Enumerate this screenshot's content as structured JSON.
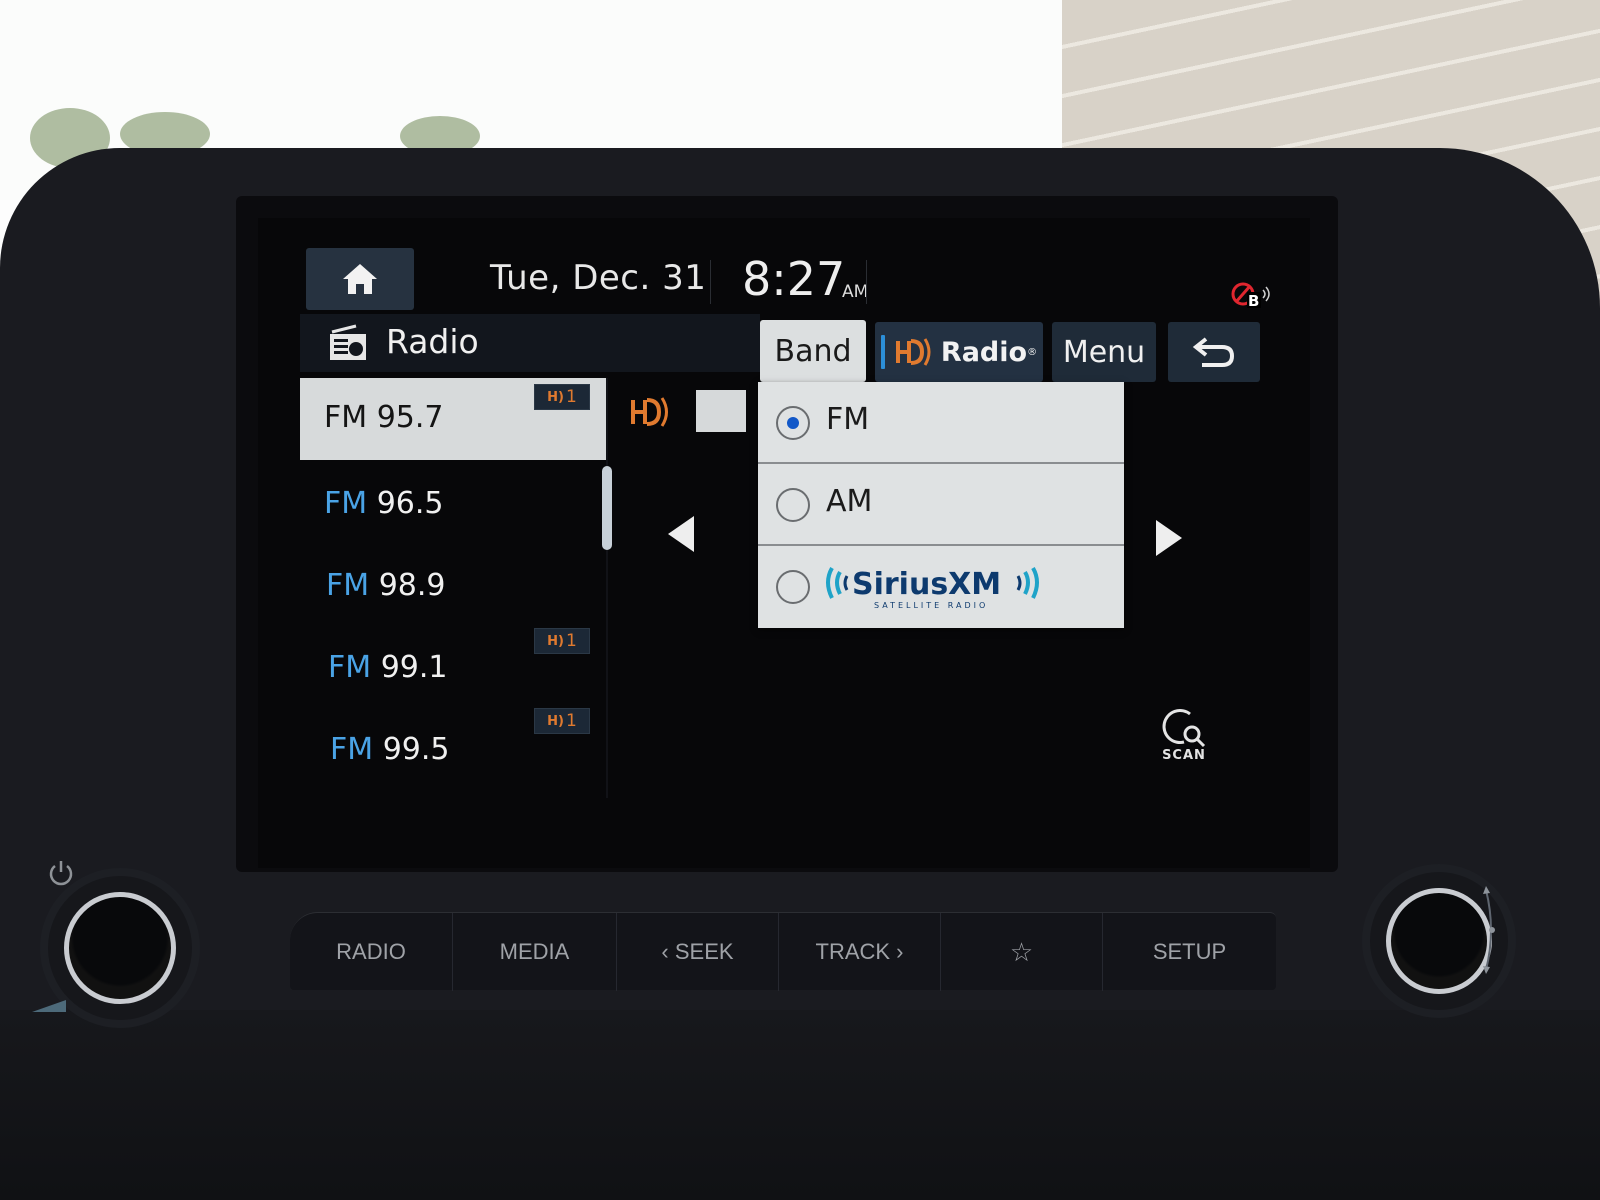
{
  "status_bar": {
    "home_icon": "home-icon",
    "date": "Tue, Dec. 31",
    "time": "8:27",
    "ampm": "AM",
    "bluetooth_status_icon": "bluetooth-disconnected-icon",
    "bluetooth_badge": "B"
  },
  "title_bar": {
    "icon": "radio-icon",
    "title": "Radio",
    "buttons": {
      "band": "Band",
      "hd_radio_prefix": "HD",
      "hd_radio": "Radio",
      "hd_radio_reg": "®",
      "menu": "Menu",
      "back_icon": "back-arrow-icon"
    }
  },
  "stations": [
    {
      "band": "FM",
      "freq": "95.7",
      "selected": true,
      "hd_badge": "1"
    },
    {
      "band": "FM",
      "freq": "96.5",
      "selected": false,
      "hd_badge": null
    },
    {
      "band": "FM",
      "freq": "98.9",
      "selected": false,
      "hd_badge": null
    },
    {
      "band": "FM",
      "freq": "99.1",
      "selected": false,
      "hd_badge": "1"
    },
    {
      "band": "FM",
      "freq": "99.5",
      "selected": false,
      "hd_badge": "1"
    }
  ],
  "band_menu": {
    "options": [
      {
        "label": "FM",
        "checked": true
      },
      {
        "label": "AM",
        "checked": false
      },
      {
        "label": "SiriusXM",
        "sublabel": "SATELLITE RADIO",
        "checked": false
      }
    ]
  },
  "now_playing": {
    "hd_icon": "hd-radio-icon",
    "prev_icon": "prev-triangle-icon",
    "next_icon": "next-triangle-icon"
  },
  "scan": {
    "label": "SCAN"
  },
  "hardware_buttons": [
    {
      "label": "RADIO"
    },
    {
      "label": "MEDIA"
    },
    {
      "label": "‹ SEEK"
    },
    {
      "label": "TRACK ›"
    },
    {
      "label": "☆",
      "icon": "star-icon"
    },
    {
      "label": "SETUP"
    }
  ],
  "colors": {
    "accent_blue": "#2c8fd8",
    "hd_orange": "#e07a2f",
    "selected_bg": "#d7dadb",
    "button_bg": "#1f2b38",
    "sxm_navy": "#0d3a6e",
    "sxm_teal": "#1fa3c8"
  }
}
